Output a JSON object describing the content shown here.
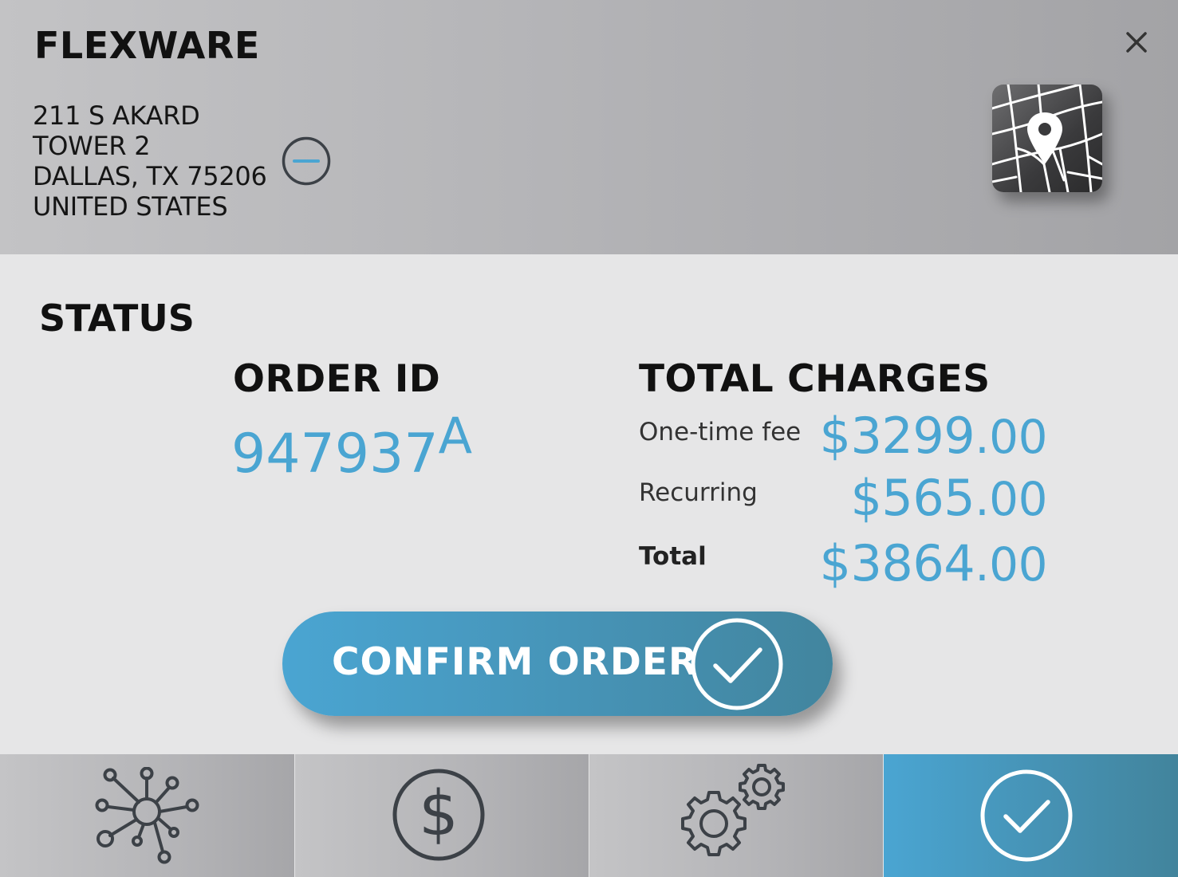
{
  "header": {
    "brand": "FLEXWARE",
    "address": [
      "211 S AKARD",
      "TOWER 2",
      "DALLAS, TX 75206",
      "UNITED STATES"
    ]
  },
  "status": {
    "title": "STATUS",
    "order_id_label": "ORDER ID",
    "order_id_number": "947937",
    "order_id_suffix": "A",
    "charges_label": "TOTAL CHARGES",
    "charges": [
      {
        "label": "One-time fee",
        "amount": "$3299",
        "cents": ".00"
      },
      {
        "label": "Recurring",
        "amount": "$565",
        "cents": ".00"
      },
      {
        "label": "Total",
        "amount": "$3864",
        "cents": ".00"
      }
    ]
  },
  "confirm_button": {
    "label": "CONFIRM ORDER"
  },
  "nav": {
    "tabs": [
      {
        "icon": "network-icon",
        "active": false
      },
      {
        "icon": "dollar-icon",
        "active": false
      },
      {
        "icon": "gears-icon",
        "active": false
      },
      {
        "icon": "check-circle-icon",
        "active": true
      }
    ]
  },
  "colors": {
    "accent": "#4aa5d2",
    "header_bg": "#b3b3b6",
    "main_bg": "#e6e6e7",
    "text_dark": "#111111"
  }
}
